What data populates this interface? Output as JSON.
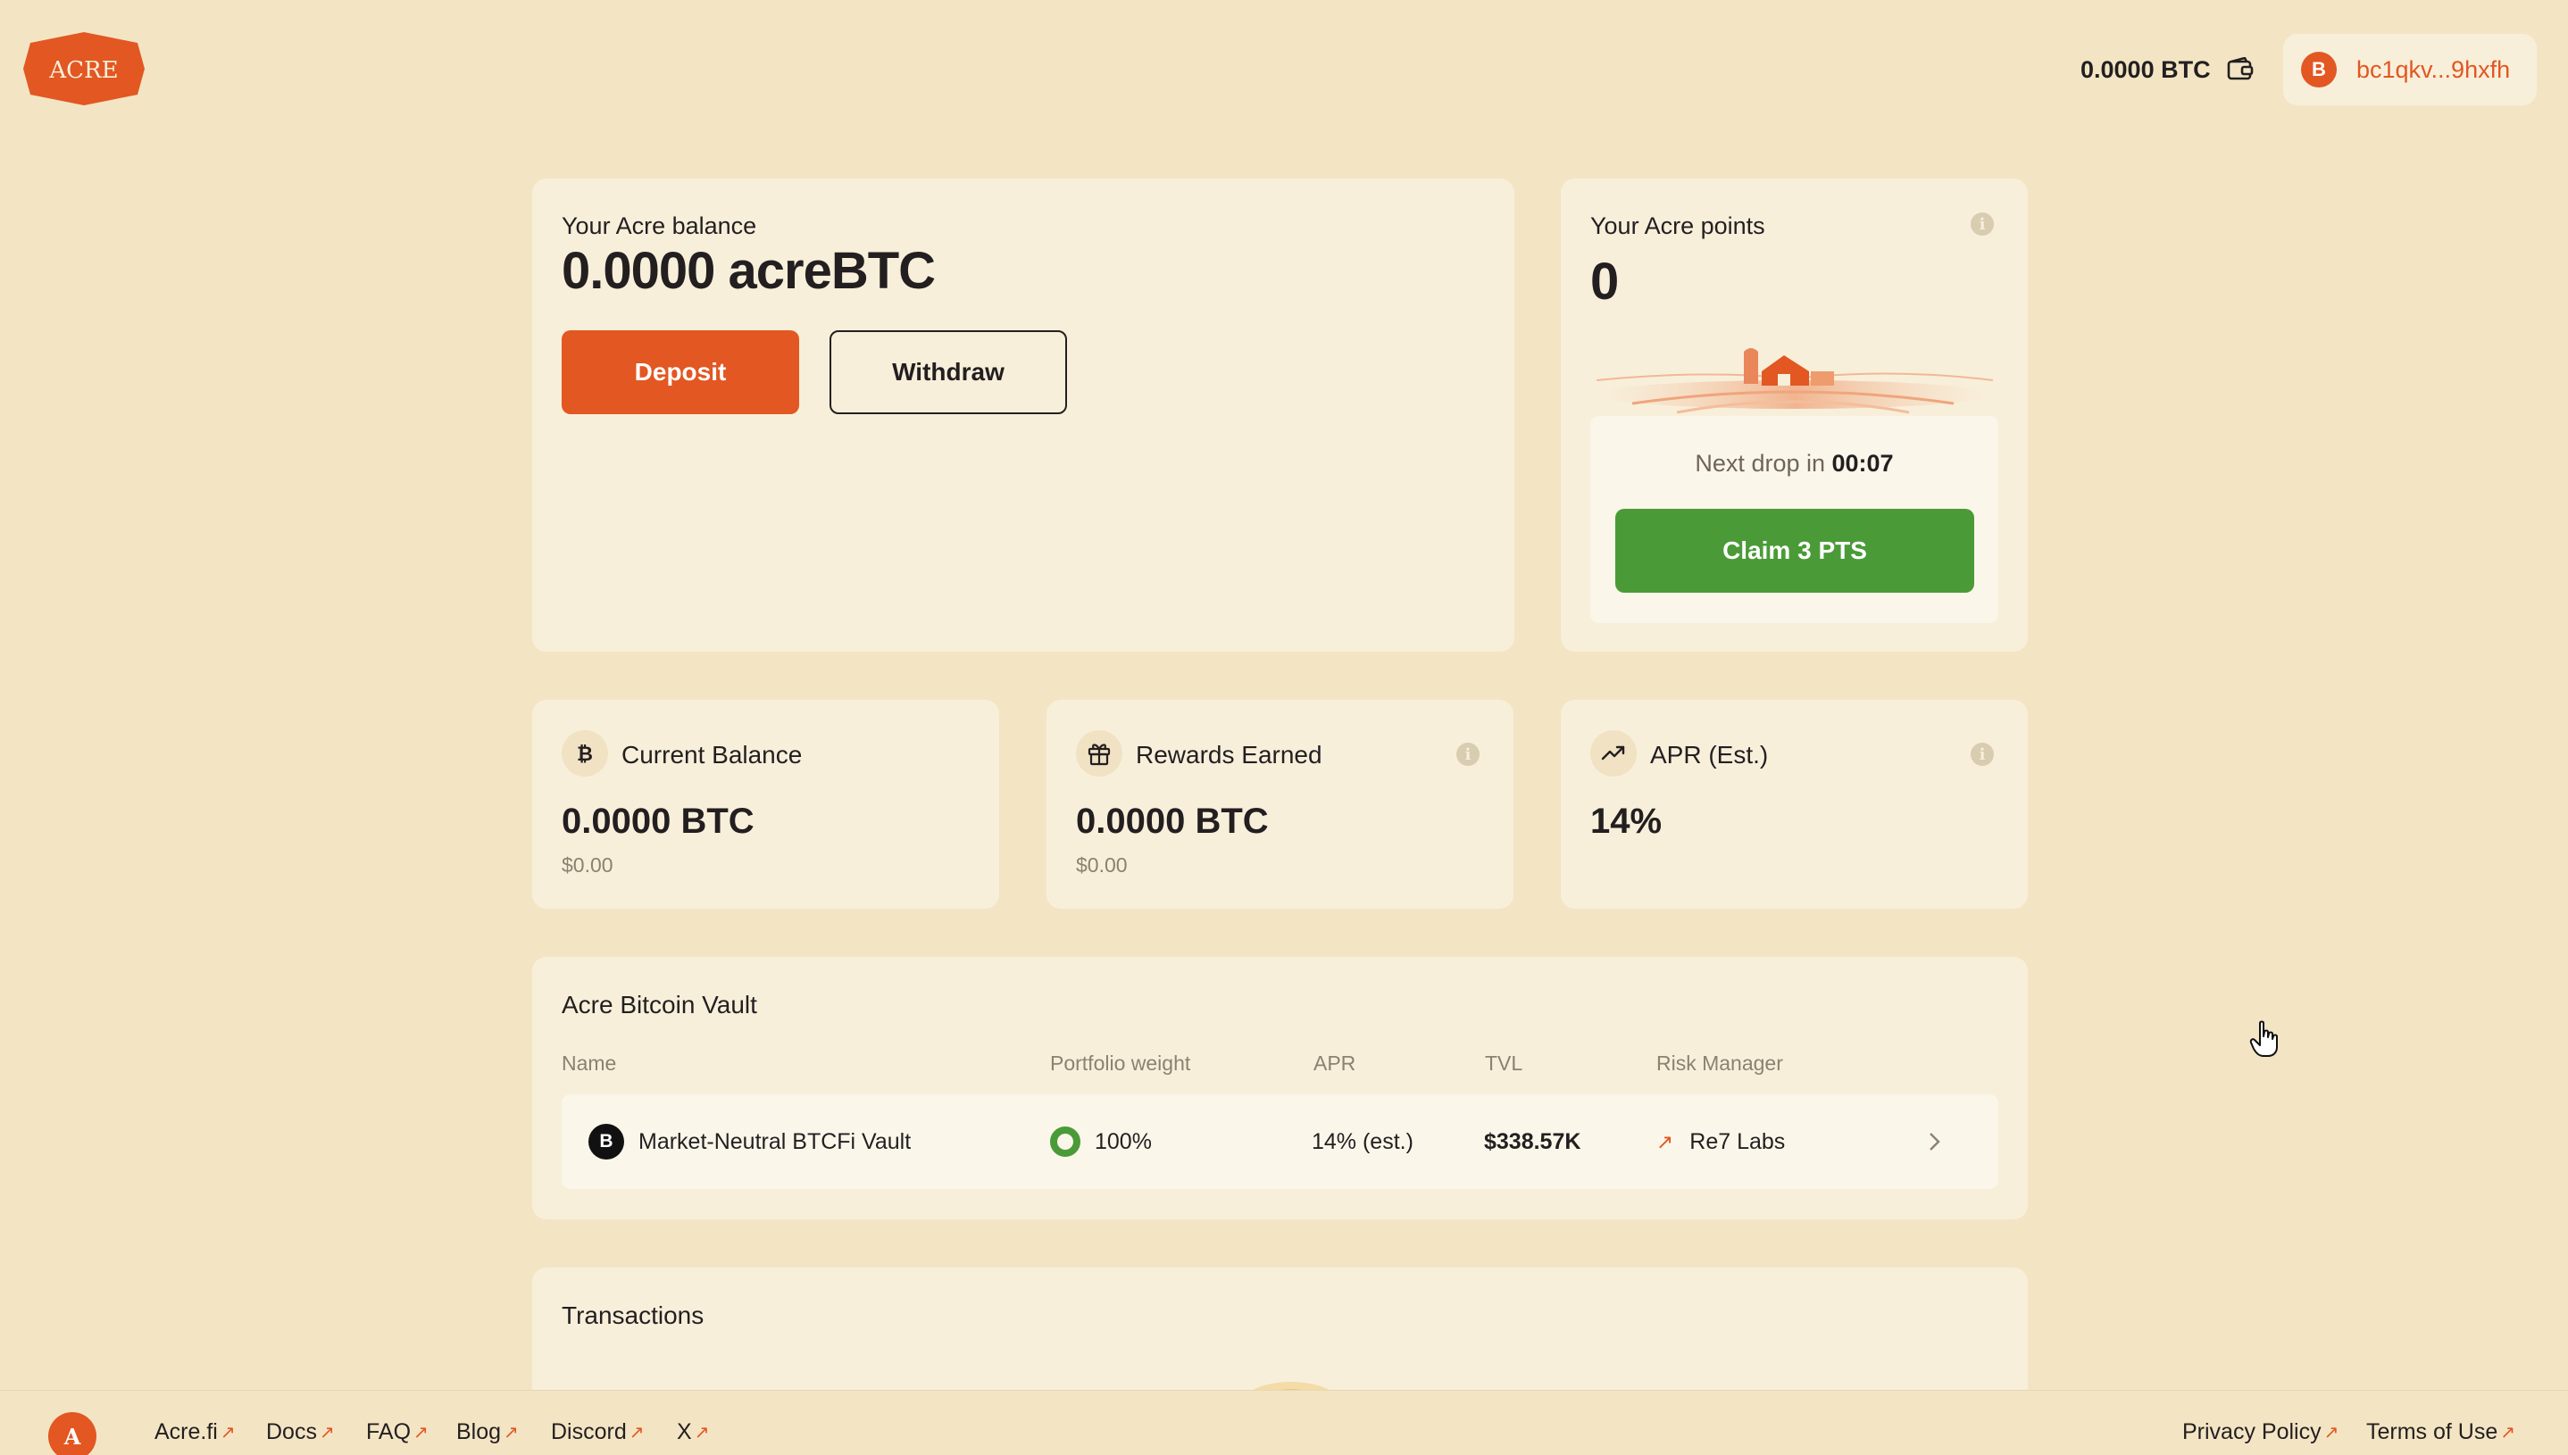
{
  "header": {
    "logo_text": "ACRE",
    "wallet_balance": "0.0000 BTC",
    "account_address": "bc1qkv...9hxfh",
    "account_icon": "B"
  },
  "balance_card": {
    "label": "Your Acre balance",
    "amount": "0.0000 acreBTC",
    "deposit_label": "Deposit",
    "withdraw_label": "Withdraw"
  },
  "points_card": {
    "label": "Your Acre points",
    "value": "0",
    "next_drop_prefix": "Next drop in",
    "next_drop_time": "00:07",
    "claim_label": "Claim 3 PTS"
  },
  "stats": [
    {
      "title": "Current Balance",
      "value": "0.0000 BTC",
      "sub": "$0.00",
      "icon": "bitcoin-icon"
    },
    {
      "title": "Rewards Earned",
      "value": "0.0000 BTC",
      "sub": "$0.00",
      "icon": "gift-icon"
    },
    {
      "title": "APR (Est.)",
      "value": "14%",
      "icon": "trending-up-icon"
    }
  ],
  "vault": {
    "title": "Acre Bitcoin Vault",
    "columns": [
      "Name",
      "Portfolio weight",
      "APR",
      "TVL",
      "Risk Manager"
    ],
    "rows": [
      {
        "name": "Market-Neutral BTCFi Vault",
        "logo": "B",
        "weight": "100%",
        "apr": "14% (est.)",
        "tvl": "$338.57K",
        "risk_manager": "Re7 Labs"
      }
    ]
  },
  "transactions": {
    "title": "Transactions"
  },
  "footer": {
    "logo_letter": "A",
    "links": [
      "Acre.fi",
      "Docs",
      "FAQ",
      "Blog",
      "Discord",
      "X"
    ],
    "right_links": [
      "Privacy Policy",
      "Terms of Use"
    ]
  },
  "colors": {
    "background": "#F3E5C4",
    "card": "#F8EFDB",
    "accent": "#E25722",
    "claim_green": "#4A9B37"
  }
}
